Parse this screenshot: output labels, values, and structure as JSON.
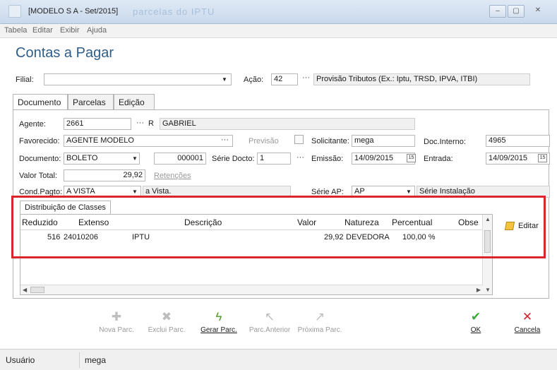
{
  "window": {
    "title": "[MODELO S A - Set/2015]",
    "blurred_title": "parcelas do IPTU",
    "minimize": "–",
    "maximize": "▢",
    "close": "✕"
  },
  "menu": [
    "Tabela",
    "Editar",
    "Exibir",
    "Ajuda"
  ],
  "page_title": "Contas a Pagar",
  "filial": {
    "label": "Filial:",
    "value": ""
  },
  "acao": {
    "label": "Ação:",
    "code": "42",
    "description": "Provisão Tributos (Ex.: Iptu, TRSD, IPVA, ITBI)"
  },
  "tabs": [
    "Documento",
    "Parcelas",
    "Edição"
  ],
  "form": {
    "agente": {
      "label": "Agente:",
      "code": "2661",
      "type": "R",
      "name": "GABRIEL"
    },
    "favorecido": {
      "label": "Favorecido:",
      "value": "AGENTE MODELO"
    },
    "previsao": {
      "label": "Previsão"
    },
    "solicitante": {
      "label": "Solicitante:",
      "value": "mega"
    },
    "doc_interno": {
      "label": "Doc.Interno:",
      "value": "4965"
    },
    "documento": {
      "label": "Documento:",
      "type": "BOLETO",
      "number": "000001"
    },
    "serie_docto": {
      "label": "Série Docto:",
      "value": "1"
    },
    "emissao": {
      "label": "Emissão:",
      "value": "14/09/2015"
    },
    "entrada": {
      "label": "Entrada:",
      "value": "14/09/2015"
    },
    "valor_total": {
      "label": "Valor Total:",
      "value": "29,92"
    },
    "retencoes": {
      "label": "Retenções"
    },
    "cond_pagto": {
      "label": "Cond.Pagto:",
      "value": "A VISTA",
      "description": "a Vista."
    },
    "serie_ap": {
      "label": "Série AP:",
      "value": "AP",
      "description": "Série Instalação"
    },
    "calendar_icon": "calendar-icon"
  },
  "subtab": "Distribuição de Classes",
  "grid": {
    "columns": [
      "Reduzido",
      "Extenso",
      "Descrição",
      "Valor",
      "Natureza",
      "Percentual",
      "Obse"
    ],
    "rows": [
      {
        "reduzido": "516",
        "extenso": "24010206",
        "descricao": "IPTU",
        "valor": "29,92",
        "natureza": "DEVEDORA",
        "percentual": "100,00 %",
        "obse": ""
      }
    ]
  },
  "edit_button": "Editar",
  "toolbar": {
    "nova_parc": "Nova Parc.",
    "exclui_parc": "Exclui Parc.",
    "gerar_parc": "Gerar Parc.",
    "parc_anterior": "Parc.Anterior",
    "proxima_parc": "Próxima Parc.",
    "ok": "OK",
    "cancela": "Cancela"
  },
  "status": {
    "label": "Usuário",
    "value": "mega"
  },
  "colors": {
    "title": "#2f5d8a",
    "highlight_border": "#d9252b",
    "ok_green": "#3aa83a",
    "cancel_red": "#c8282d",
    "gerar_green": "#4f9a2a"
  }
}
